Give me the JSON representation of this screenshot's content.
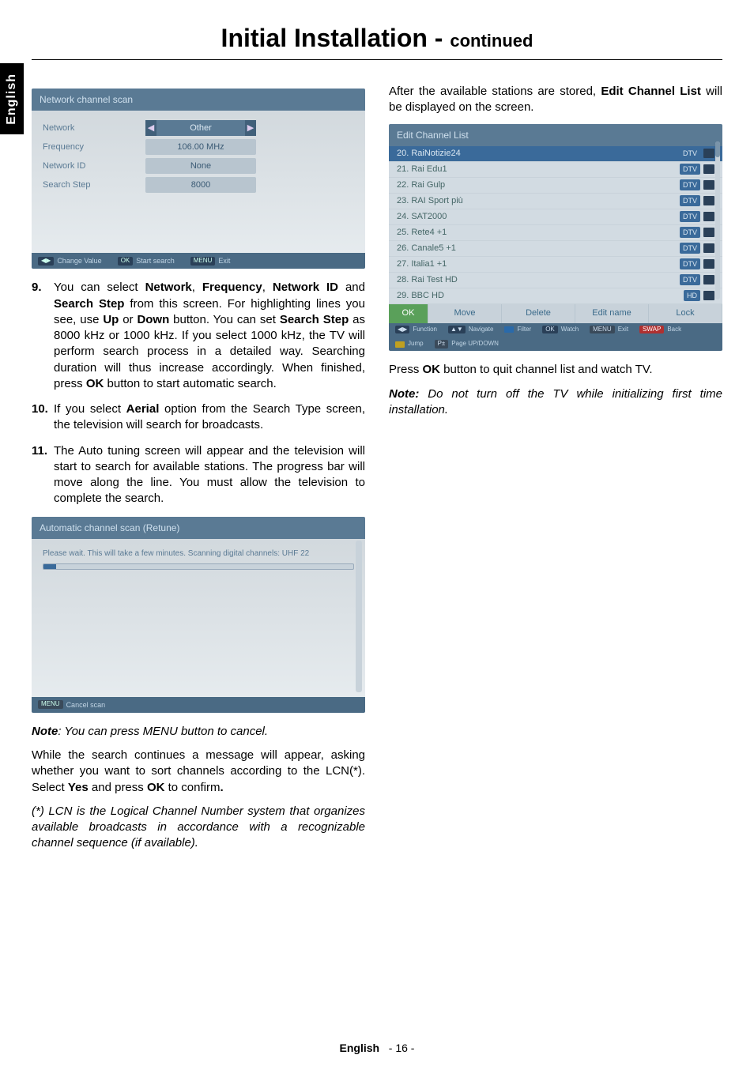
{
  "title_main": "Initial Installation - ",
  "title_sub": "continued",
  "side_tab": "English",
  "footer_lang": "English",
  "footer_page": "- 16 -",
  "osd_network": {
    "title": "Network channel scan",
    "rows": [
      {
        "label": "Network",
        "value": "Other",
        "highlight": true,
        "arrows": true
      },
      {
        "label": "Frequency",
        "value": "106.00 MHz"
      },
      {
        "label": "Network ID",
        "value": "None"
      },
      {
        "label": "Search Step",
        "value": "8000"
      }
    ],
    "hints": [
      {
        "key": "◀▶",
        "text": "Change Value"
      },
      {
        "key": "OK",
        "text": "Start search"
      },
      {
        "key": "MENU",
        "text": "Exit"
      }
    ]
  },
  "list_items": {
    "item9_num": "9.",
    "item9_a": "You can select ",
    "item9_net": "Network",
    "item9_b": ", ",
    "item9_freq": "Frequency",
    "item9_c": ", ",
    "item9_nid": "Network ID",
    "item9_d": " and ",
    "item9_ss": "Search Step",
    "item9_e": " from this screen. For highlighting lines you see, use ",
    "item9_up": "Up",
    "item9_f": " or ",
    "item9_down": "Down",
    "item9_g": " button. You can set ",
    "item9_ss2": "Search Step",
    "item9_h": " as 8000 kHz or 1000 kHz. If you select 1000 kHz, the TV will perform search process in a detailed way. Searching duration will thus increase accordingly. When finished, press ",
    "item9_ok": "OK",
    "item9_i": " button to start automatic search.",
    "item10_num": "10.",
    "item10_a": "If you select ",
    "item10_aerial": "Aerial",
    "item10_b": " option from the Search Type screen, the television will search for broadcasts.",
    "item11_num": "11.",
    "item11_a": "The Auto tuning screen will appear and the television will start to search for available stations. The progress bar will move along the line. You must allow the television to complete the search."
  },
  "osd_scan": {
    "title": "Automatic channel scan (Retune)",
    "message": "Please wait. This will take a few minutes. Scanning digital channels: UHF 22",
    "hint_key": "MENU",
    "hint_text": "Cancel scan"
  },
  "note1_prefix": "Note",
  "note1_body": ": You can press MENU button to cancel.",
  "para_lcn_a": "While the search continues a message will appear, asking whether you want to sort channels according to the LCN(*). Select ",
  "para_lcn_yes": "Yes",
  "para_lcn_b": " and press ",
  "para_lcn_ok": "OK",
  "para_lcn_c": " to confirm",
  "para_lcn_dot": ".",
  "lcn_note": "(*) LCN is the Logical Channel Number system that organizes available broadcasts in accordance with a recognizable channel sequence (if available).",
  "col2_intro_a": "After the available stations are stored, ",
  "col2_intro_bold": "Edit Channel List",
  "col2_intro_b": " will be displayed on the screen.",
  "osd_ecl": {
    "title": "Edit Channel List",
    "rows": [
      {
        "name": "20. RaiNotizie24",
        "tag": "DTV",
        "sel": true
      },
      {
        "name": "21. Rai Edu1",
        "tag": "DTV"
      },
      {
        "name": "22. Rai Gulp",
        "tag": "DTV"
      },
      {
        "name": "23. RAI Sport più",
        "tag": "DTV"
      },
      {
        "name": "24. SAT2000",
        "tag": "DTV"
      },
      {
        "name": "25. Rete4 +1",
        "tag": "DTV"
      },
      {
        "name": "26. Canale5 +1",
        "tag": "DTV"
      },
      {
        "name": "27. Italia1 +1",
        "tag": "DTV"
      },
      {
        "name": "28. Rai Test HD",
        "tag": "DTV"
      },
      {
        "name": "29. BBC HD",
        "tag": "HD"
      }
    ],
    "actions": [
      "OK",
      "Move",
      "Delete",
      "Edit name",
      "Lock"
    ],
    "hints": [
      {
        "chip": "arrows",
        "text": "Function"
      },
      {
        "chip": "updown",
        "text": "Navigate"
      },
      {
        "chip": "blue",
        "text": "Filter"
      },
      {
        "chip": "ok",
        "text": "Watch"
      },
      {
        "chip": "menu",
        "text": "Exit"
      },
      {
        "chip": "swap",
        "text": "Back"
      },
      {
        "chip": "yellow",
        "text": "Jump"
      },
      {
        "chip": "p",
        "text": "Page UP/DOWN"
      }
    ]
  },
  "col2_press_a": "Press ",
  "col2_press_ok": "OK",
  "col2_press_b": " button to quit channel list and watch TV.",
  "col2_note_prefix": "Note:",
  "col2_note_body": " Do not turn off the TV while initializing first time installation."
}
